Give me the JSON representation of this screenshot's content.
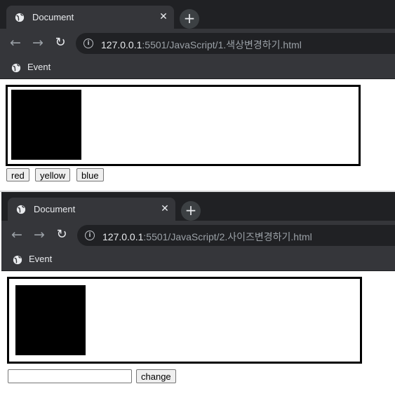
{
  "windows": [
    {
      "tab": {
        "title": "Document",
        "close": "✕"
      },
      "new_tab": "+",
      "nav": {
        "back": "←",
        "forward": "→",
        "reload": "↻",
        "info": "i"
      },
      "address": {
        "host": "127.0.0.1",
        "path": ":5501/JavaScript/1.색상변경하기.html"
      },
      "bookmark": {
        "label": "Event"
      },
      "page": {
        "buttons": [
          "red",
          "yellow",
          "blue"
        ]
      }
    },
    {
      "tab": {
        "title": "Document",
        "close": "✕"
      },
      "new_tab": "+",
      "nav": {
        "back": "←",
        "forward": "→",
        "reload": "↻",
        "info": "i"
      },
      "address": {
        "host": "127.0.0.1",
        "path": ":5501/JavaScript/2.사이즈변경하기.html"
      },
      "bookmark": {
        "label": "Event"
      },
      "page": {
        "input_value": "",
        "change_button": "change"
      }
    }
  ],
  "colors": {
    "tabstrip": "#202124",
    "toolbar": "#35363a",
    "box": "#000000"
  }
}
